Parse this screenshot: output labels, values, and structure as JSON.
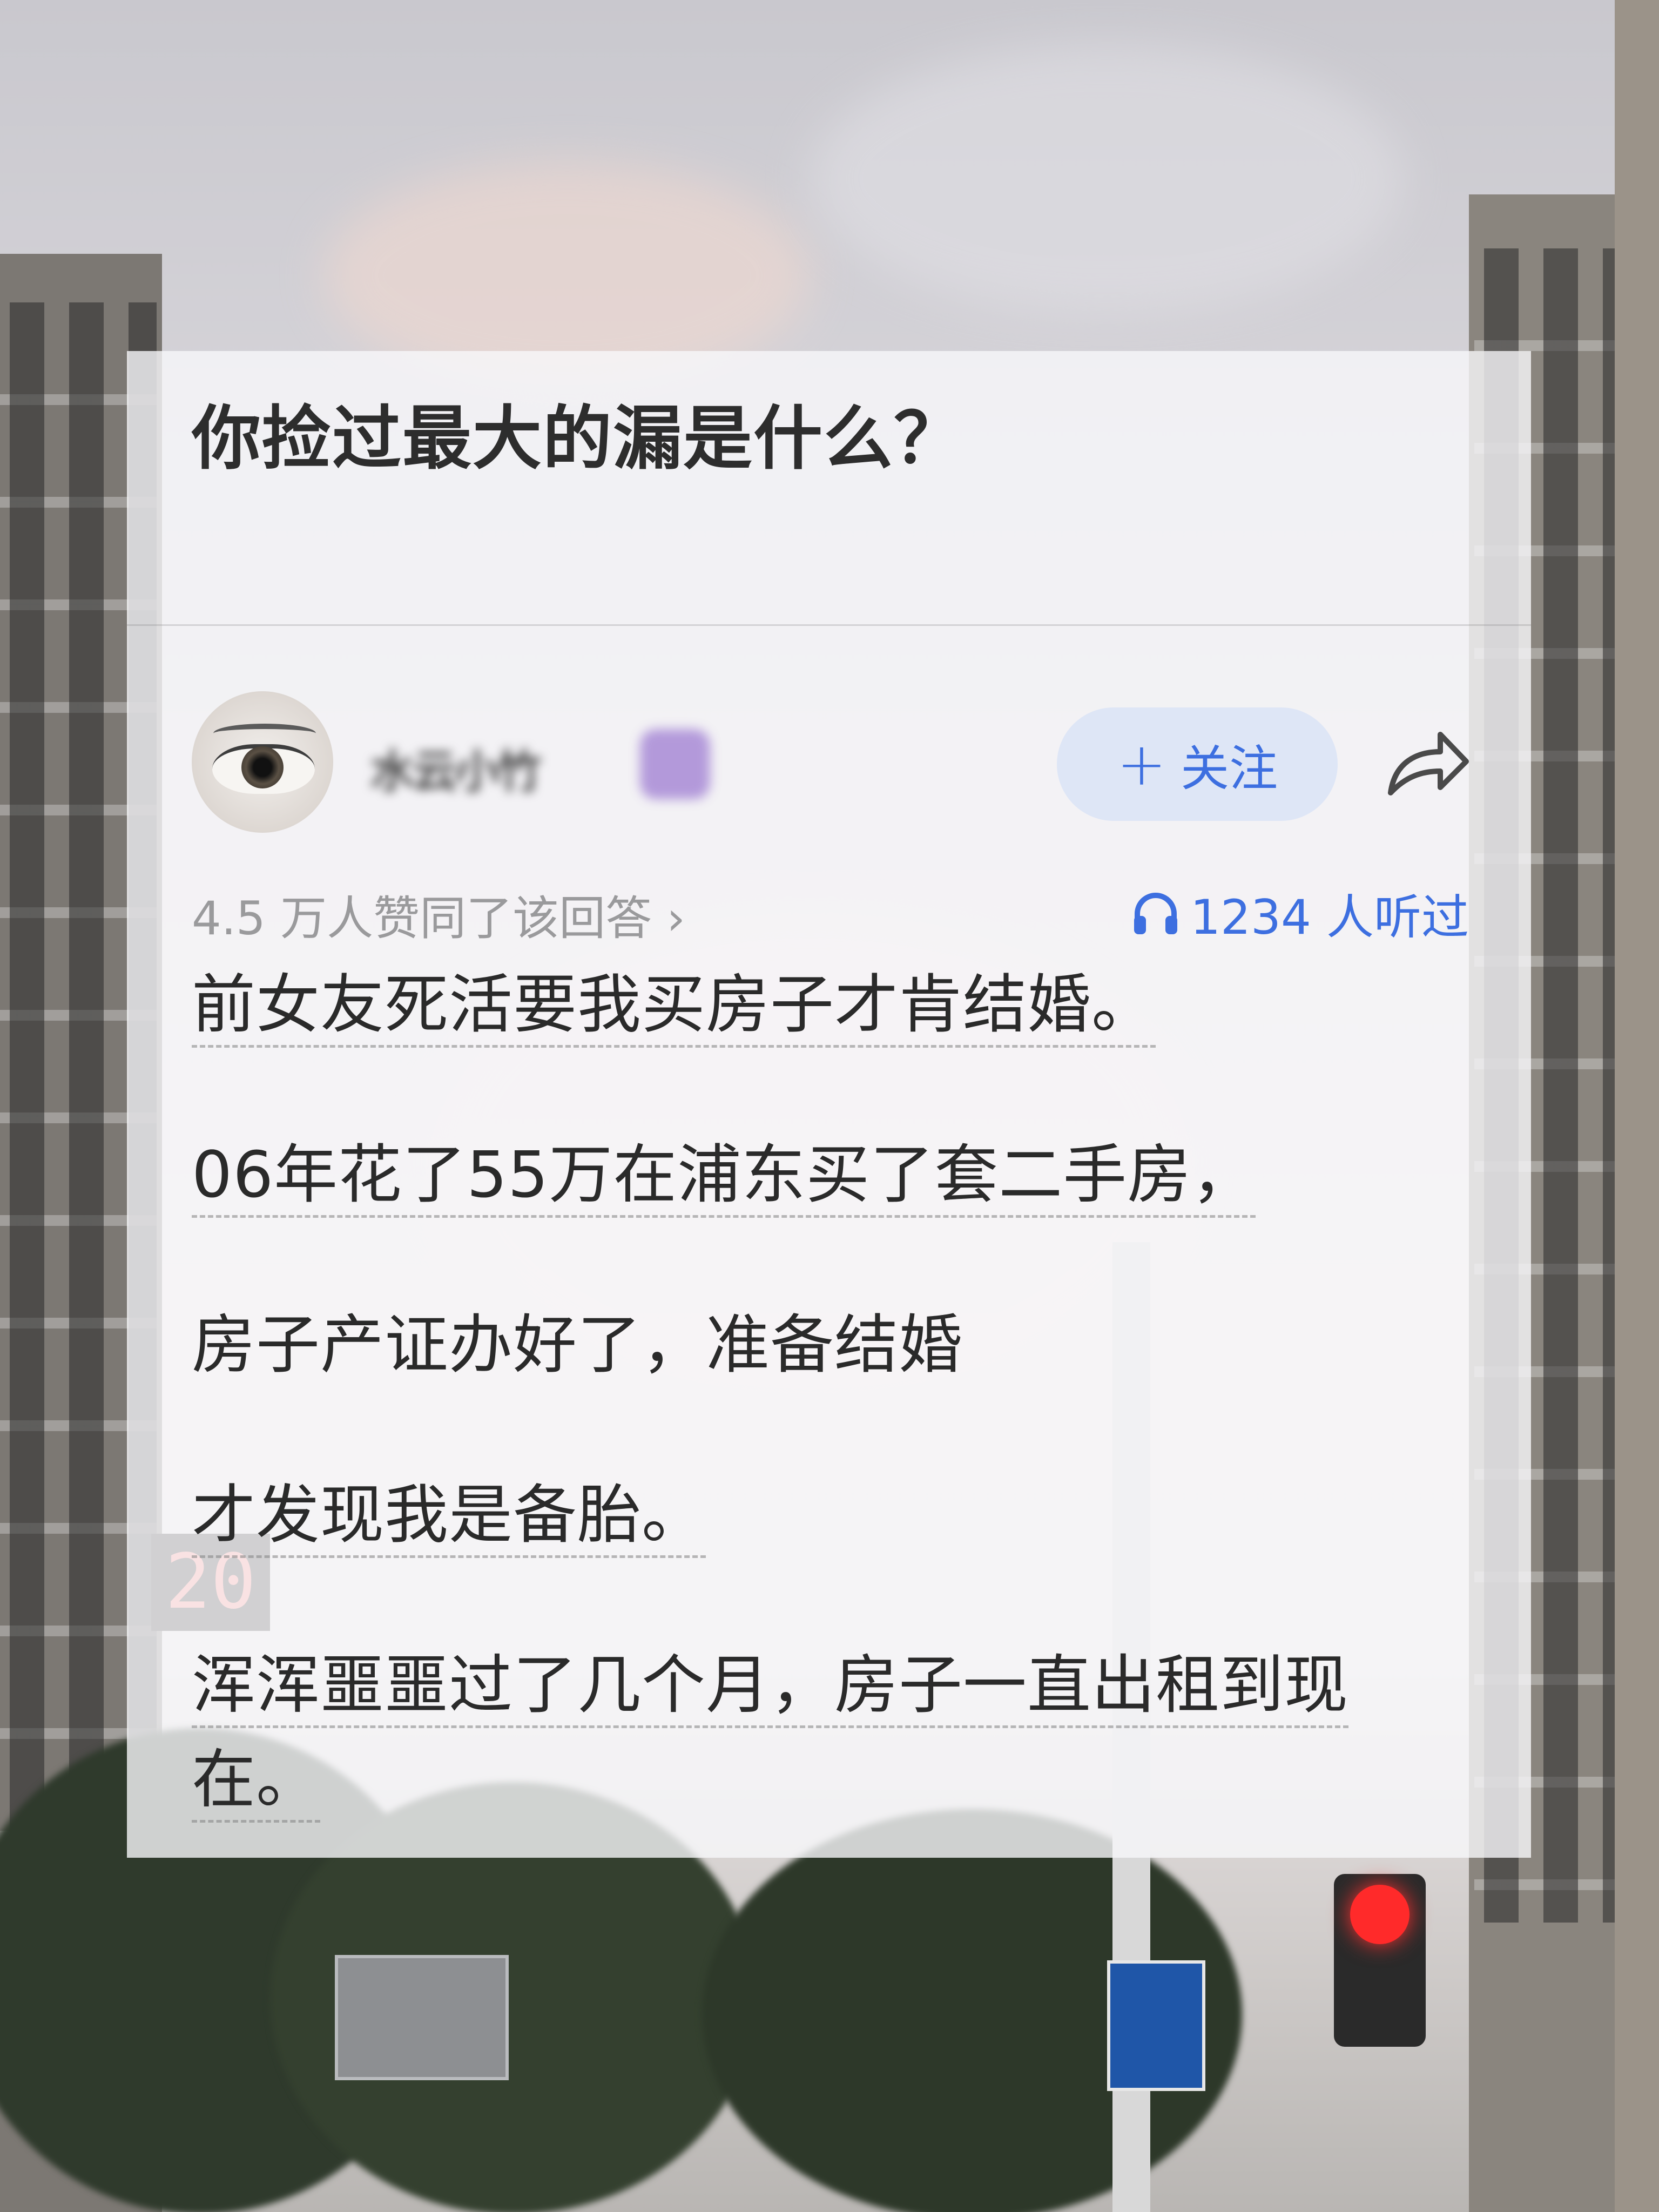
{
  "question": {
    "title": "你捡过最大的漏是什么？"
  },
  "answer": {
    "author_name": "水云小竹",
    "follow_label": "关注",
    "likes_text": "4.5 万人赞同了该回答 ›",
    "listens_text": "1234 人听过",
    "paragraphs": [
      "前女友死活要我买房子才肯结婚。",
      "06年花了55万在浦东买了套二手房，",
      "房子产证办好了，准备结婚",
      "才发现我是备胎。",
      "浑浑噩噩过了几个月，房子一直出租到现",
      "在。"
    ]
  },
  "icons": {
    "share": "share-icon",
    "headset": "headset-icon",
    "plus": "plus-icon"
  },
  "colors": {
    "accent": "#3d6fe0",
    "card_bg": "#f8f8fa",
    "muted_text": "#9a9a9c"
  }
}
